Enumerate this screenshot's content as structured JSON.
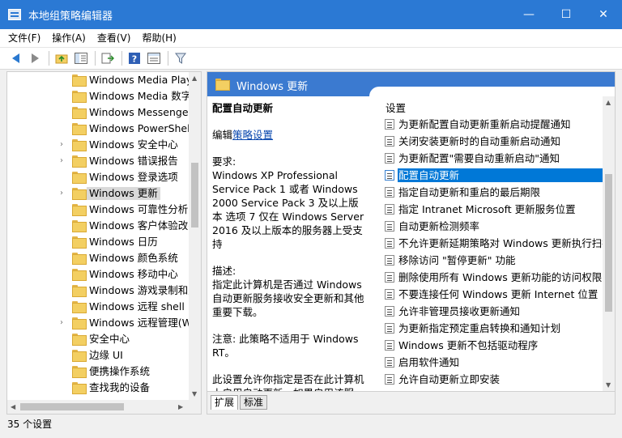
{
  "window": {
    "title": "本地组策略编辑器",
    "minimize": "—",
    "maximize": "☐",
    "close": "✕"
  },
  "menu": [
    "文件(F)",
    "操作(A)",
    "查看(V)",
    "帮助(H)"
  ],
  "tree": {
    "items": [
      {
        "label": "Windows Media Play",
        "expandable": false
      },
      {
        "label": "Windows Media 数字",
        "expandable": false
      },
      {
        "label": "Windows Messenger",
        "expandable": false
      },
      {
        "label": "Windows PowerShell",
        "expandable": false
      },
      {
        "label": "Windows 安全中心",
        "expandable": true
      },
      {
        "label": "Windows 错误报告",
        "expandable": true
      },
      {
        "label": "Windows 登录选项",
        "expandable": false
      },
      {
        "label": "Windows 更新",
        "expandable": true,
        "selected": true
      },
      {
        "label": "Windows 可靠性分析",
        "expandable": false
      },
      {
        "label": "Windows 客户体验改善",
        "expandable": false
      },
      {
        "label": "Windows 日历",
        "expandable": false
      },
      {
        "label": "Windows 颜色系统",
        "expandable": false
      },
      {
        "label": "Windows 移动中心",
        "expandable": false
      },
      {
        "label": "Windows 游戏录制和广",
        "expandable": false
      },
      {
        "label": "Windows 远程 shell",
        "expandable": false
      },
      {
        "label": "Windows 远程管理(W",
        "expandable": true
      },
      {
        "label": "安全中心",
        "expandable": false
      },
      {
        "label": "边缘 UI",
        "expandable": false
      },
      {
        "label": "便携操作系统",
        "expandable": false
      },
      {
        "label": "查找我的设备",
        "expandable": false
      }
    ]
  },
  "header": {
    "title": "Windows 更新"
  },
  "description": {
    "title": "配置自动更新",
    "edit_prefix": "编辑",
    "edit_link": "策略设置",
    "requirements_label": "要求:",
    "requirements": "Windows XP Professional Service Pack 1 或者 Windows 2000 Service Pack 3 及以上版本 选项 7 仅在 Windows Server 2016 及以上版本的服务器上受支持",
    "desc_label": "描述:",
    "desc": "指定此计算机是否通过 Windows 自动更新服务接收安全更新和其他重要下载。",
    "note": "注意: 此策略不适用于 Windows RT。",
    "more": "此设置允许你指定是否在此计算机上启用自动更新。如果启用该服"
  },
  "settings": {
    "column_header": "设置",
    "rows": [
      {
        "label": "为更新配置自动更新重新启动提醒通知"
      },
      {
        "label": "关闭安装更新时的自动重新启动通知"
      },
      {
        "label": "为更新配置\"需要自动重新启动\"通知"
      },
      {
        "label": "配置自动更新",
        "selected": true
      },
      {
        "label": "指定自动更新和重启的最后期限"
      },
      {
        "label": "指定 Intranet Microsoft 更新服务位置"
      },
      {
        "label": "自动更新检测频率"
      },
      {
        "label": "不允许更新延期策略对 Windows 更新执行扫描"
      },
      {
        "label": "移除访问 \"暂停更新\" 功能"
      },
      {
        "label": "删除使用所有 Windows 更新功能的访问权限"
      },
      {
        "label": "不要连接任何 Windows 更新 Internet 位置"
      },
      {
        "label": "允许非管理员接收更新通知"
      },
      {
        "label": "为更新指定预定重启转换和通知计划"
      },
      {
        "label": "Windows 更新不包括驱动程序"
      },
      {
        "label": "启用软件通知"
      },
      {
        "label": "允许自动更新立即安装"
      }
    ]
  },
  "tabs": [
    "扩展",
    "标准"
  ],
  "status": "35 个设置"
}
